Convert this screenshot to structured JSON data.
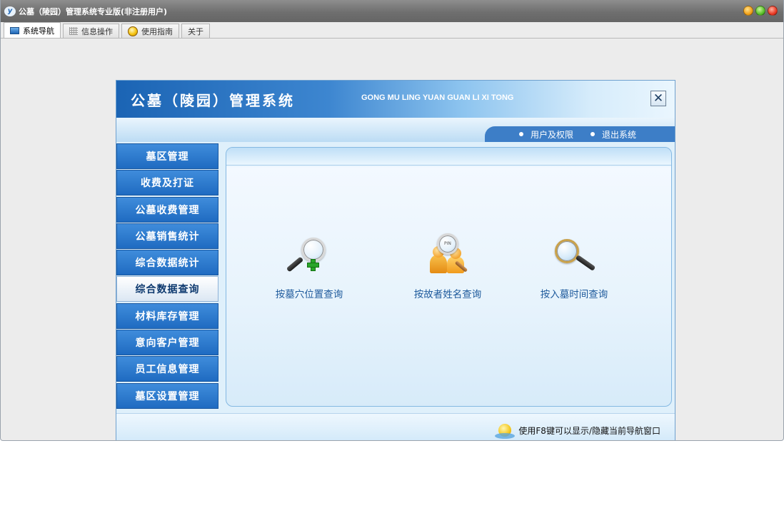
{
  "window": {
    "title": "公墓（陵园）管理系统专业版(非注册用户)",
    "logo_text": "y"
  },
  "tabs": [
    {
      "label": "系统导航",
      "icon": "monitor-icon",
      "active": true
    },
    {
      "label": "信息操作",
      "icon": "grid-icon",
      "active": false
    },
    {
      "label": "使用指南",
      "icon": "coin-icon",
      "active": false
    },
    {
      "label": "关于",
      "icon": "",
      "active": false
    }
  ],
  "banner": {
    "title": "公墓（陵园）管理系统",
    "pinyin": "GONG MU LING YUAN GUAN LI XI TONG",
    "close_glyph": "✕"
  },
  "top_links": [
    {
      "label": "用户及权限"
    },
    {
      "label": "退出系统"
    }
  ],
  "sidebar": {
    "items": [
      {
        "label": "墓区管理"
      },
      {
        "label": "收费及打证"
      },
      {
        "label": "公墓收费管理"
      },
      {
        "label": "公墓销售统计"
      },
      {
        "label": "综合数据统计"
      },
      {
        "label": "综合数据查询",
        "active": true
      },
      {
        "label": "材料库存管理"
      },
      {
        "label": "意向客户管理"
      },
      {
        "label": "员工信息管理"
      },
      {
        "label": "墓区设置管理"
      }
    ]
  },
  "queries": [
    {
      "label": "按墓穴位置查询",
      "icon": "magnifier-plus-icon"
    },
    {
      "label": "按故者姓名查询",
      "icon": "people-search-icon",
      "icon_text": "PIN"
    },
    {
      "label": "按入墓时间查询",
      "icon": "magnifier-icon"
    }
  ],
  "footer": {
    "tip": "使用F8键可以显示/隐藏当前导航窗口"
  }
}
